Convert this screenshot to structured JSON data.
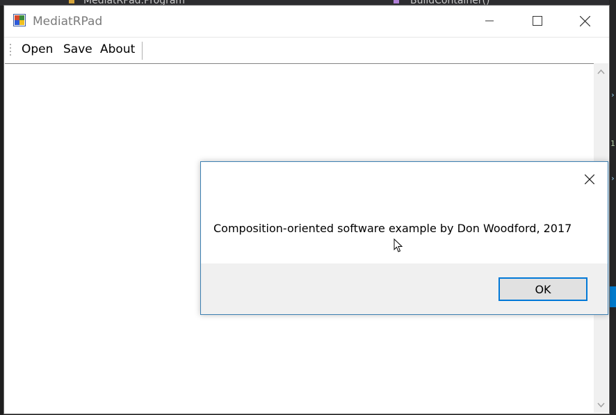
{
  "background": {
    "ide_tab_left": "MediatRPad.Program",
    "ide_tab_right": "BuildContainer()"
  },
  "window": {
    "title": "MediatRPad",
    "controls": {
      "minimize": "minimize-icon",
      "maximize": "maximize-icon",
      "close": "close-icon"
    }
  },
  "menu": {
    "items": [
      {
        "label": "Open"
      },
      {
        "label": "Save"
      },
      {
        "label": "About"
      }
    ]
  },
  "dialog": {
    "message": "Composition-oriented software example by Don Woodford, 2017",
    "ok_label": "OK",
    "accent": "#0078d7"
  }
}
